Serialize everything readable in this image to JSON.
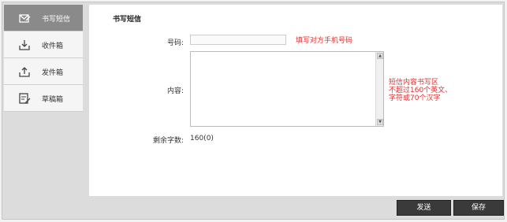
{
  "sidebar": {
    "items": [
      {
        "label": "书写短信",
        "icon": "compose-icon",
        "active": true
      },
      {
        "label": "收件箱",
        "icon": "inbox-icon",
        "active": false
      },
      {
        "label": "发件箱",
        "icon": "outbox-icon",
        "active": false
      },
      {
        "label": "草稿箱",
        "icon": "drafts-icon",
        "active": false
      }
    ]
  },
  "main": {
    "title": "书写短信",
    "number_label": "号码:",
    "number_value": "",
    "number_hint": "填写对方手机号码",
    "content_label": "内容:",
    "content_value": "",
    "content_hint": "短信内容书写区\n不超过160个英文、\n字符或70个汉字",
    "remaining_label": "剩余字数:",
    "remaining_value": "160(0)"
  },
  "actions": {
    "send_label": "发送",
    "save_label": "保存"
  },
  "colors": {
    "hint": "#e03030",
    "active_nav": "#8a8a8a",
    "button": "#3a3a3a"
  }
}
